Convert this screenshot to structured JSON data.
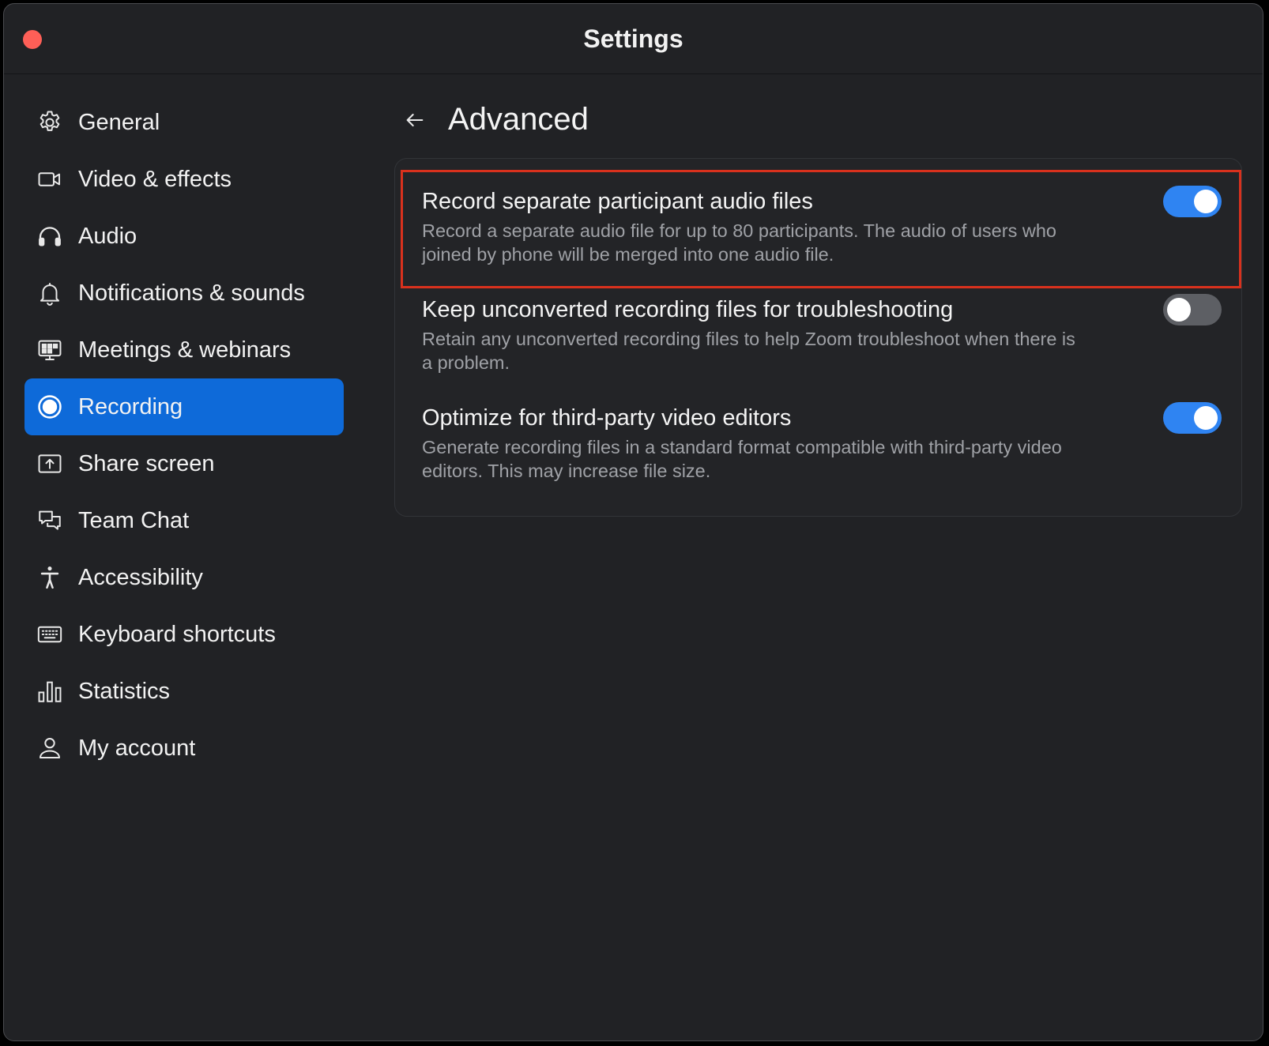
{
  "window": {
    "title": "Settings",
    "close_button_color": "#fe5f57"
  },
  "sidebar": {
    "active_color": "#0e6ad9",
    "items": [
      {
        "label": "General",
        "icon": "gear-icon"
      },
      {
        "label": "Video & effects",
        "icon": "video-camera-icon"
      },
      {
        "label": "Audio",
        "icon": "headphones-icon"
      },
      {
        "label": "Notifications & sounds",
        "icon": "bell-icon"
      },
      {
        "label": "Meetings & webinars",
        "icon": "meetings-icon"
      },
      {
        "label": "Recording",
        "icon": "record-icon",
        "active": true
      },
      {
        "label": "Share screen",
        "icon": "share-screen-icon"
      },
      {
        "label": "Team Chat",
        "icon": "chat-bubbles-icon"
      },
      {
        "label": "Accessibility",
        "icon": "accessibility-icon"
      },
      {
        "label": "Keyboard shortcuts",
        "icon": "keyboard-icon"
      },
      {
        "label": "Statistics",
        "icon": "bar-chart-icon"
      },
      {
        "label": "My account",
        "icon": "user-icon"
      }
    ]
  },
  "content": {
    "back_icon": "arrow-left-icon",
    "title": "Advanced",
    "settings": [
      {
        "title": "Record separate participant audio files",
        "description": "Record a separate audio file for up to 80 participants. The audio of users who joined by phone will be merged into one audio file.",
        "enabled": true,
        "highlighted": true
      },
      {
        "title": "Keep unconverted recording files for troubleshooting",
        "description": "Retain any unconverted recording files to help Zoom troubleshoot when there is a problem.",
        "enabled": false
      },
      {
        "title": "Optimize for third-party video editors",
        "description": "Generate recording files in a standard format compatible with third-party video editors. This may increase file size.",
        "enabled": true
      }
    ]
  },
  "colors": {
    "toggle_on": "#2f84f2",
    "toggle_off": "#5d5f64",
    "highlight_border": "#d9311d"
  }
}
